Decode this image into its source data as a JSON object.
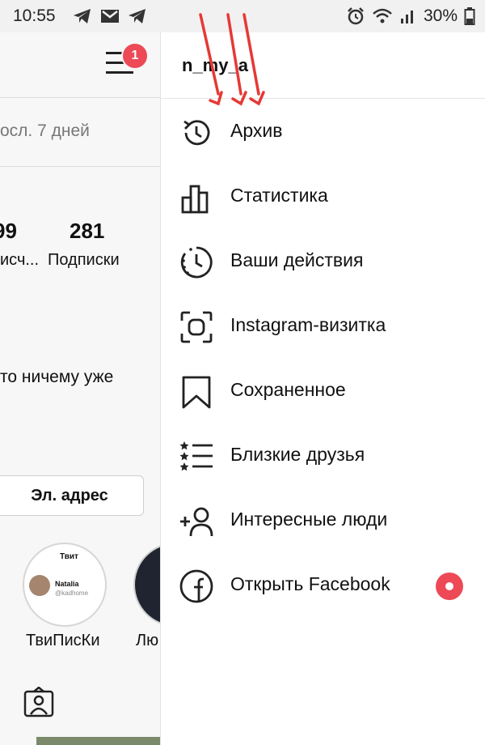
{
  "status_bar": {
    "time": "10:55",
    "left_icons": [
      "telegram-icon",
      "gmail-icon",
      "telegram-icon"
    ],
    "right_icons": [
      "alarm-icon",
      "wifi-icon",
      "signal-icon"
    ],
    "battery": "30%"
  },
  "profile": {
    "period_text": "осл. 7 дней",
    "followers_count": "99",
    "followers_label": "исч...",
    "following_count": "281",
    "following_label": "Подписки",
    "bio_text": "то ничему уже",
    "email_button": "Эл. адрес",
    "highlights": [
      {
        "label": "ТвиПисКи",
        "thumb_title": "Твит",
        "thumb_name": "Natalia",
        "thumb_handle": "@kadhome"
      },
      {
        "label": "Лю"
      }
    ],
    "notification_count": "1"
  },
  "drawer": {
    "username": "n_my_a",
    "items": [
      {
        "label": "Архив",
        "icon": "archive-history-icon"
      },
      {
        "label": "Статистика",
        "icon": "insights-bar-chart-icon"
      },
      {
        "label": "Ваши действия",
        "icon": "your-activity-clock-icon"
      },
      {
        "label": "Instagram-визитка",
        "icon": "nametag-scan-icon"
      },
      {
        "label": "Сохраненное",
        "icon": "bookmark-icon"
      },
      {
        "label": "Близкие друзья",
        "icon": "close-friends-list-icon"
      },
      {
        "label": "Интересные люди",
        "icon": "discover-people-icon"
      },
      {
        "label": "Открыть Facebook",
        "icon": "facebook-icon"
      }
    ]
  },
  "colors": {
    "badge_red": "#ed4956",
    "annotation_arrow": "#e53935"
  }
}
